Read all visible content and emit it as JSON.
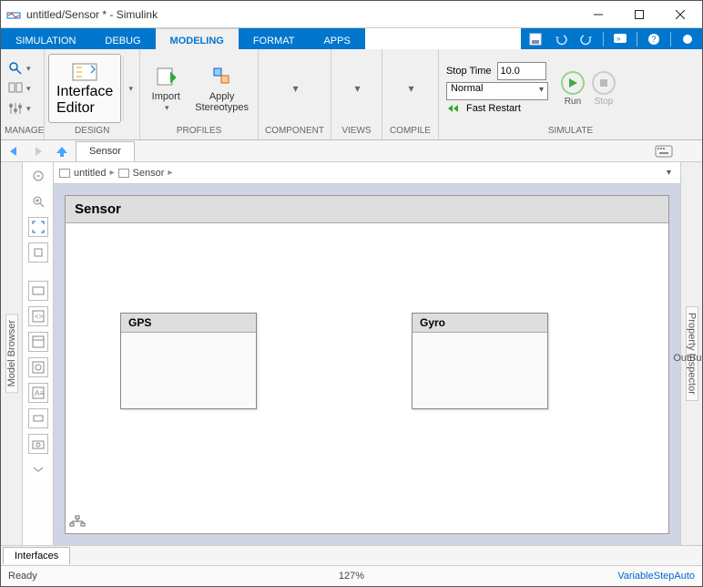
{
  "window": {
    "title": "untitled/Sensor * - Simulink"
  },
  "tabs": {
    "simulation": "SIMULATION",
    "debug": "DEBUG",
    "modeling": "MODELING",
    "format": "FORMAT",
    "apps": "APPS"
  },
  "ribbon": {
    "manage": {
      "label": "MANAGE"
    },
    "design": {
      "label": "DESIGN",
      "interface_editor": "Interface\nEditor"
    },
    "profiles": {
      "label": "PROFILES",
      "import": "Import",
      "apply_stereotypes": "Apply\nStereotypes"
    },
    "component": {
      "label": "COMPONENT"
    },
    "views": {
      "label": "VIEWS"
    },
    "compile": {
      "label": "COMPILE"
    },
    "simulate": {
      "label": "SIMULATE",
      "stop_time_label": "Stop Time",
      "stop_time_value": "10.0",
      "mode": "Normal",
      "fast_restart": "Fast Restart",
      "run": "Run",
      "stop": "Stop"
    }
  },
  "leftRail": {
    "label": "Model Browser"
  },
  "rightRail": {
    "label": "Property Inspector"
  },
  "nav": {
    "tab": "Sensor"
  },
  "breadcrumb": {
    "root": "untitled",
    "child": "Sensor"
  },
  "canvas": {
    "title": "Sensor",
    "blocks": {
      "gps": "GPS",
      "gyro": "Gyro"
    },
    "outport": "OutBus"
  },
  "bottomTabs": {
    "interfaces": "Interfaces"
  },
  "status": {
    "ready": "Ready",
    "zoom": "127%",
    "solver": "VariableStepAuto"
  }
}
